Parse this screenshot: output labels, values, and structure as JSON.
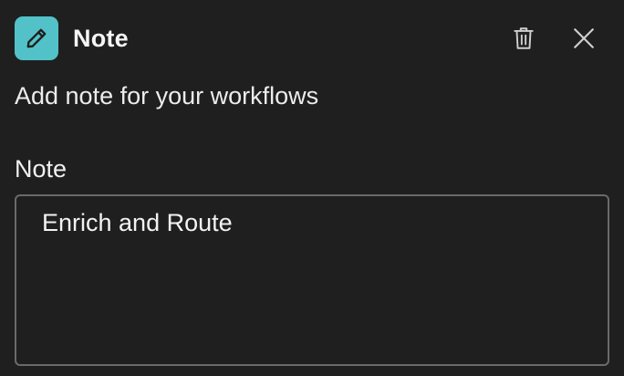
{
  "header": {
    "title": "Note",
    "app_icon": "pencil-icon",
    "accent_color": "#52c2c8",
    "actions": [
      {
        "name": "delete",
        "icon": "trash-icon"
      },
      {
        "name": "close",
        "icon": "close-icon"
      }
    ]
  },
  "description": "Add note for your workflows",
  "note_field": {
    "label": "Note",
    "value": "Enrich and Route"
  }
}
